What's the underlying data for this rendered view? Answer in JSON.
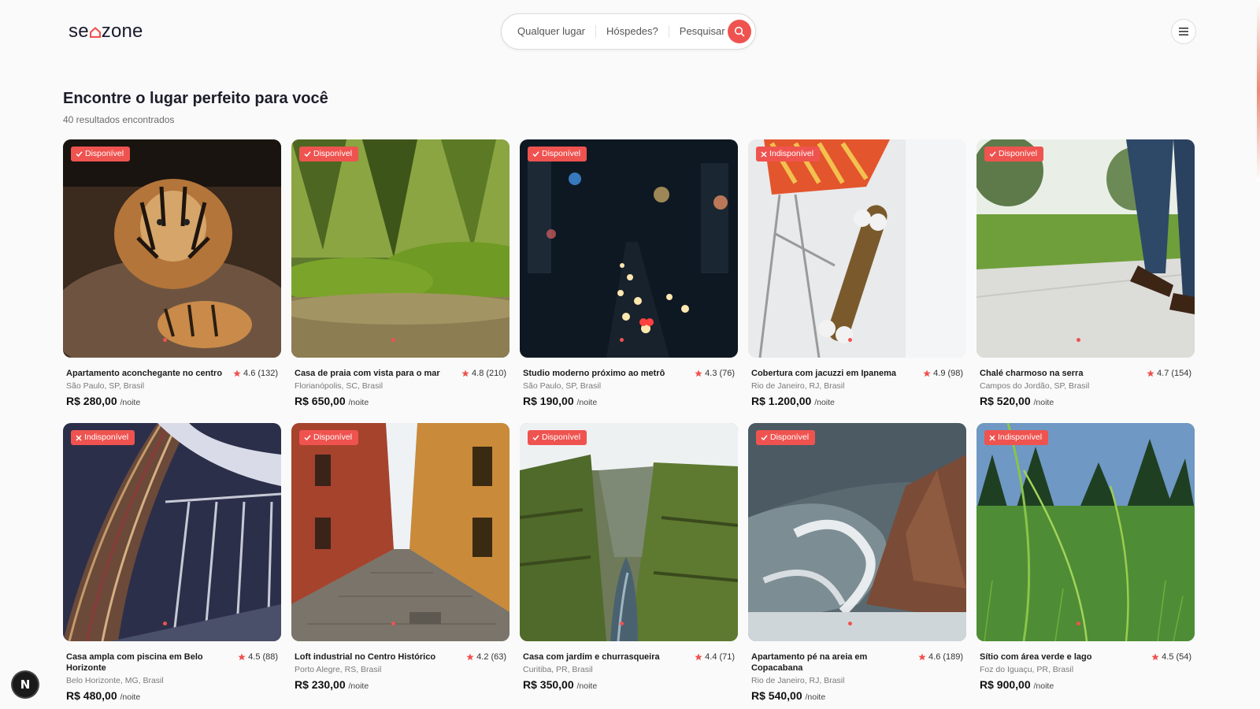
{
  "header": {
    "logo_prefix": "se",
    "logo_suffix": "zone",
    "search": {
      "where": "Qualquer lugar",
      "guests": "Hóspedes?",
      "submit": "Pesquisar"
    }
  },
  "main": {
    "title": "Encontre o lugar perfeito para você",
    "results_count": "40 resultados encontrados"
  },
  "colors": {
    "accent": "#ef5350",
    "text": "#1d1d2b"
  },
  "listings": [
    {
      "title": "Apartamento aconchegante no centro",
      "rating": "4.6",
      "reviews": "(132)",
      "location": "São Paulo, SP, Brasil",
      "price": "R$ 280,00",
      "unit": "/noite",
      "badge": "Disponível",
      "available": true,
      "image": "tiger"
    },
    {
      "title": "Casa de praia com vista para o mar",
      "rating": "4.8",
      "reviews": "(210)",
      "location": "Florianópolis, SC, Brasil",
      "price": "R$ 650,00",
      "unit": "/noite",
      "badge": "Disponível",
      "available": true,
      "image": "forest-moss"
    },
    {
      "title": "Studio moderno próximo ao metrô",
      "rating": "4.3",
      "reviews": "(76)",
      "location": "São Paulo, SP, Brasil",
      "price": "R$ 190,00",
      "unit": "/noite",
      "badge": "Disponível",
      "available": true,
      "image": "city-night"
    },
    {
      "title": "Cobertura com jacuzzi em Ipanema",
      "rating": "4.9",
      "reviews": "(98)",
      "location": "Rio de Janeiro, RJ, Brasil",
      "price": "R$ 1.200,00",
      "unit": "/noite",
      "badge": "Indisponível",
      "available": false,
      "image": "skateboard"
    },
    {
      "title": "Chalé charmoso na serra",
      "rating": "4.7",
      "reviews": "(154)",
      "location": "Campos do Jordão, SP, Brasil",
      "price": "R$ 520,00",
      "unit": "/noite",
      "badge": "Disponível",
      "available": true,
      "image": "park-walk"
    },
    {
      "title": "Casa ampla com piscina em Belo Horizonte",
      "rating": "4.5",
      "reviews": "(88)",
      "location": "Belo Horizonte, MG, Brasil",
      "price": "R$ 480,00",
      "unit": "/noite",
      "badge": "Indisponível",
      "available": false,
      "image": "library"
    },
    {
      "title": "Loft industrial no Centro Histórico",
      "rating": "4.2",
      "reviews": "(63)",
      "location": "Porto Alegre, RS, Brasil",
      "price": "R$ 230,00",
      "unit": "/noite",
      "badge": "Disponível",
      "available": true,
      "image": "alley"
    },
    {
      "title": "Casa com jardim e churrasqueira",
      "rating": "4.4",
      "reviews": "(71)",
      "location": "Curitiba, PR, Brasil",
      "price": "R$ 350,00",
      "unit": "/noite",
      "badge": "Disponível",
      "available": true,
      "image": "canyon"
    },
    {
      "title": "Apartamento pé na areia em Copacabana",
      "rating": "4.6",
      "reviews": "(189)",
      "location": "Rio de Janeiro, RJ, Brasil",
      "price": "R$ 540,00",
      "unit": "/noite",
      "badge": "Disponível",
      "available": true,
      "image": "waves"
    },
    {
      "title": "Sítio com área verde e lago",
      "rating": "4.5",
      "reviews": "(54)",
      "location": "Foz do Iguaçu, PR, Brasil",
      "price": "R$ 900,00",
      "unit": "/noite",
      "badge": "Indisponível",
      "available": false,
      "image": "grass"
    }
  ],
  "dev_badge": "N"
}
